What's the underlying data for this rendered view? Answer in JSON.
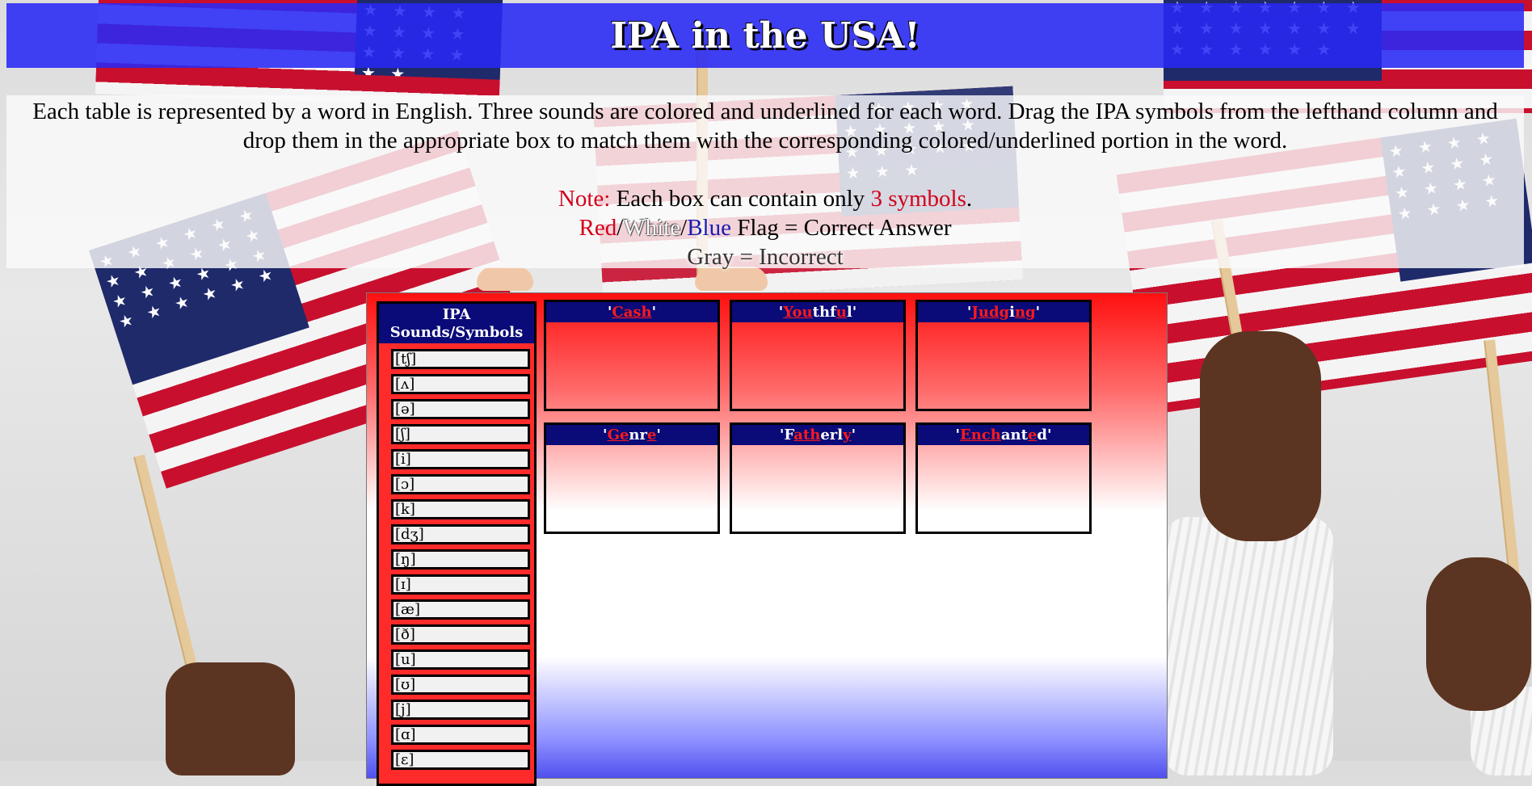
{
  "header": {
    "title": "IPA in the USA!"
  },
  "instructions": {
    "main": "Each table is represented by a word in English. Three sounds are colored and underlined for each word. Drag the IPA symbols from the lefthand column and drop them in the appropriate box to match them with the corresponding colored/underlined portion in the word.",
    "note_label": "Note:",
    "note_text_1": " Each box can contain only ",
    "note_highlight": "3 symbols",
    "note_text_2": ".",
    "flag_red": "Red",
    "flag_sep_1": "/",
    "flag_white": "White",
    "flag_sep_2": "/",
    "flag_blue": "Blue",
    "flag_text": " Flag = Correct Answer",
    "gray_line": "Gray = Incorrect"
  },
  "symbols_column": {
    "header_line1": "IPA",
    "header_line2": "Sounds/Symbols",
    "items": [
      "[tʃ]",
      "[ʌ]",
      "[ə]",
      "[ʃ]",
      "[i]",
      "[ɔ]",
      "[k]",
      "[dʒ]",
      "[ŋ]",
      "[ɪ]",
      "[æ]",
      "[ð]",
      "[u]",
      "[ʊ]",
      "[j]",
      "[ɑ]",
      "[ɛ]"
    ]
  },
  "word_boxes": [
    {
      "parts": [
        [
          "'",
          false
        ],
        [
          "Cash",
          true
        ],
        [
          "'",
          false
        ]
      ]
    },
    {
      "parts": [
        [
          "'",
          false
        ],
        [
          "You",
          true
        ],
        [
          "thf",
          false
        ],
        [
          "u",
          true
        ],
        [
          "l'",
          false
        ]
      ]
    },
    {
      "parts": [
        [
          "'",
          false
        ],
        [
          "Judg",
          true
        ],
        [
          "i",
          false
        ],
        [
          "ng",
          true
        ],
        [
          "'",
          false
        ]
      ]
    },
    {
      "parts": [
        [
          "'",
          false
        ],
        [
          "Ge",
          true
        ],
        [
          "nr",
          false
        ],
        [
          "e",
          true
        ],
        [
          "'",
          false
        ]
      ]
    },
    {
      "parts": [
        [
          "'F",
          false
        ],
        [
          "ath",
          true
        ],
        [
          "erl",
          false
        ],
        [
          "y",
          true
        ],
        [
          "'",
          false
        ]
      ]
    },
    {
      "parts": [
        [
          "'",
          false
        ],
        [
          "Ench",
          true
        ],
        [
          "ant",
          false
        ],
        [
          "e",
          true
        ],
        [
          "d'",
          false
        ]
      ]
    }
  ],
  "colors": {
    "title_bar": "#2828f5",
    "highlight": "#ff1a1a",
    "header_navy": "#0a0a78"
  },
  "background_icons": [
    "us-flag-icon",
    "us-flag-icon",
    "us-flag-icon",
    "us-flag-icon"
  ]
}
